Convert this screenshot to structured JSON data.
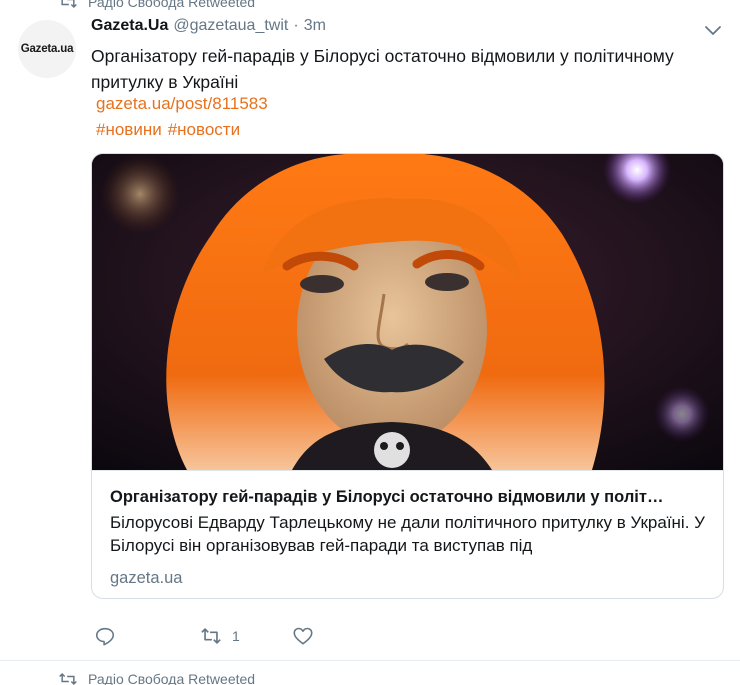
{
  "retweet_banner_top": {
    "text": "Радіо Свобода Retweeted"
  },
  "retweet_banner_bottom": {
    "text": "Радіо Свобода Retweeted"
  },
  "tweet": {
    "avatar_text": "Gazeta.ua",
    "author_name": "Gazeta.Ua",
    "author_handle": "@gazetaua_twit",
    "separator": "·",
    "time": "3m",
    "text": "Організатору гей-парадів у Білорусі остаточно відмовили у політичному притулку в Україні",
    "link": "gazeta.ua/post/811583",
    "hashtags": [
      "#новини",
      "#новости"
    ],
    "card": {
      "title": "Організатору гей-парадів у Білорусі остаточно відмовили у політ…",
      "description": "Білорусові Едварду Тарлецькому не дали політичного притулку в Україні. У Білорусі він організовував гей-паради та виступав під",
      "domain": "gazeta.ua"
    },
    "actions": {
      "reply_count": "",
      "retweet_count": "1",
      "like_count": ""
    }
  },
  "icons": {
    "retweet_banner": "retweet-icon",
    "caret": "chevron-down-icon",
    "reply": "reply-icon",
    "retweet": "retweet-icon",
    "like": "heart-icon"
  },
  "colors": {
    "link": "#e8711d",
    "muted": "#657786",
    "text": "#14171a",
    "border": "#d8dee3"
  }
}
